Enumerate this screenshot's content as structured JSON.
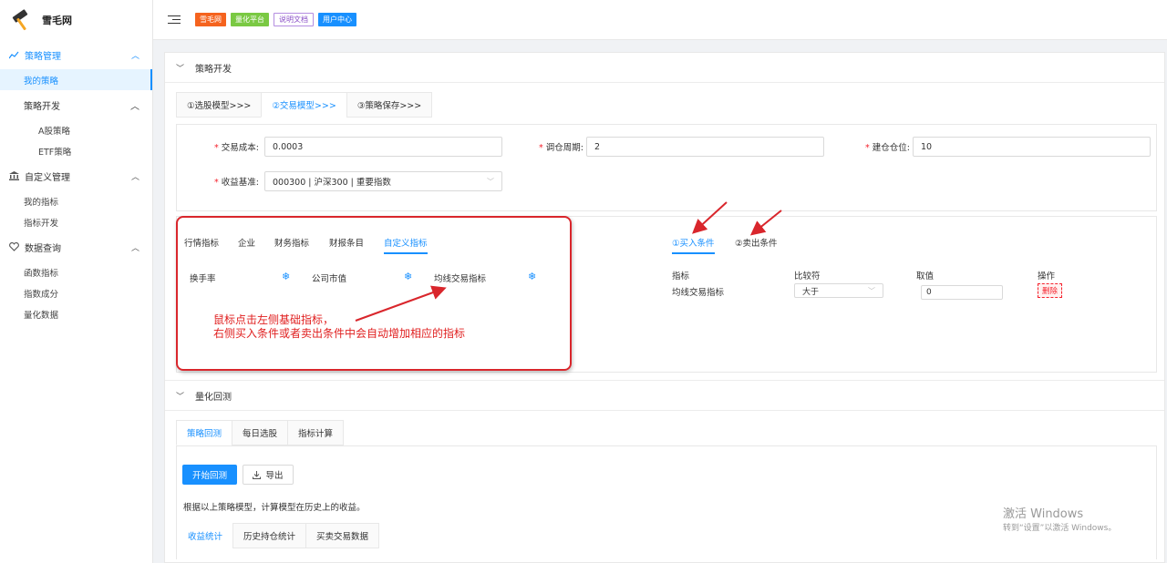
{
  "app": {
    "name": "雪毛网"
  },
  "sidebar": {
    "groups": [
      {
        "label": "策略管理",
        "icon": "line-chart-icon",
        "items": [
          "我的策略"
        ]
      },
      {
        "label": "策略开发",
        "items": [
          "A股策略",
          "ETF策略"
        ]
      },
      {
        "label": "自定义管理",
        "icon": "bank-icon",
        "items": [
          "我的指标",
          "指标开发"
        ]
      },
      {
        "label": "数据查询",
        "icon": "heart-icon",
        "items": [
          "函数指标",
          "指数成分",
          "量化数据"
        ]
      }
    ]
  },
  "topbar": {
    "badges": [
      {
        "label": "雪毛网",
        "bg": "#f5631e",
        "fg": "#ffffff"
      },
      {
        "label": "量化平台",
        "bg": "#7ac943",
        "fg": "#ffffff"
      },
      {
        "label": "说明文档",
        "bg": "#ffffff",
        "fg": "#8a4fc7",
        "border": "#b48ee0"
      },
      {
        "label": "用户中心",
        "bg": "#1890ff",
        "fg": "#ffffff"
      }
    ]
  },
  "strategy_dev": {
    "title": "策略开发",
    "tabs": [
      "①选股模型>>>",
      "②交易模型>>>",
      "③策略保存>>>"
    ],
    "active_tab": 1,
    "form": {
      "cost": {
        "label": "交易成本:",
        "value": "0.0003"
      },
      "period": {
        "label": "调仓周期:",
        "value": "2"
      },
      "position": {
        "label": "建仓仓位:",
        "value": "10"
      },
      "benchmark": {
        "label": "收益基准:",
        "value": "000300 | 沪深300 | 重要指数"
      }
    },
    "indicator_tabs": [
      "行情指标",
      "企业",
      "财务指标",
      "财报条目",
      "自定义指标"
    ],
    "active_indicator_tab": 4,
    "indicators": [
      "换手率",
      "公司市值",
      "均线交易指标"
    ],
    "condition_tabs": [
      "①买入条件",
      "②卖出条件"
    ],
    "active_condition_tab": 0,
    "condition_table": {
      "headers": [
        "指标",
        "比较符",
        "取值",
        "操作"
      ],
      "rows": [
        {
          "indicator": "均线交易指标",
          "op": "大于",
          "value": "0",
          "action": "删除"
        }
      ]
    },
    "annotation": {
      "line1": "鼠标点击左侧基础指标，",
      "line2": "右侧买入条件或者卖出条件中会自动增加相应的指标"
    }
  },
  "backtest": {
    "title": "量化回测",
    "tabs": [
      "策略回测",
      "每日选股",
      "指标计算"
    ],
    "active_tab": 0,
    "start_button": "开始回测",
    "export_button": "导出",
    "description": "根据以上策略模型，计算模型在历史上的收益。",
    "result_tabs": [
      "收益统计",
      "历史持仓统计",
      "买卖交易数据"
    ],
    "active_result_tab": 0
  },
  "watermark": {
    "line1": "激活 Windows",
    "line2": "转到“设置”以激活 Windows。"
  }
}
